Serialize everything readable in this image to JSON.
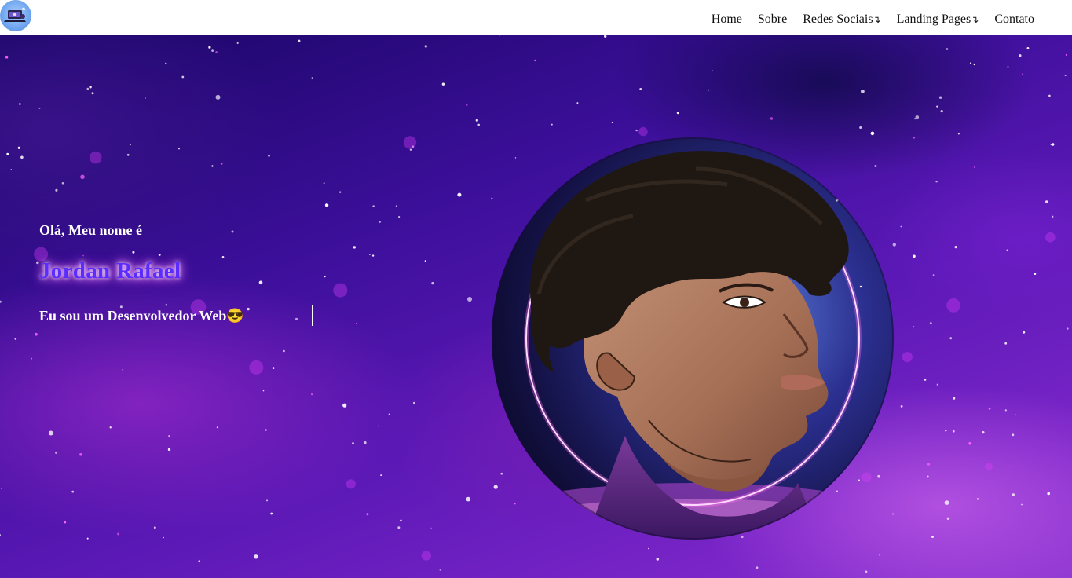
{
  "nav": {
    "logo": "computer-logo-icon",
    "links": [
      {
        "label": "Home"
      },
      {
        "label": "Sobre"
      },
      {
        "label": "Redes Sociais",
        "arrow": "↴"
      },
      {
        "label": "Landing Pages",
        "arrow": "↴"
      },
      {
        "label": "Contato"
      }
    ]
  },
  "hero": {
    "greeting": "Olá, Meu nome é",
    "name": "Jordan Rafael",
    "role": "Eu sou um Desenvolvedor Web😎",
    "portrait": "avatar-illustration",
    "colors": {
      "name": "#5b2cff",
      "ring": "#ff6cf0"
    }
  }
}
